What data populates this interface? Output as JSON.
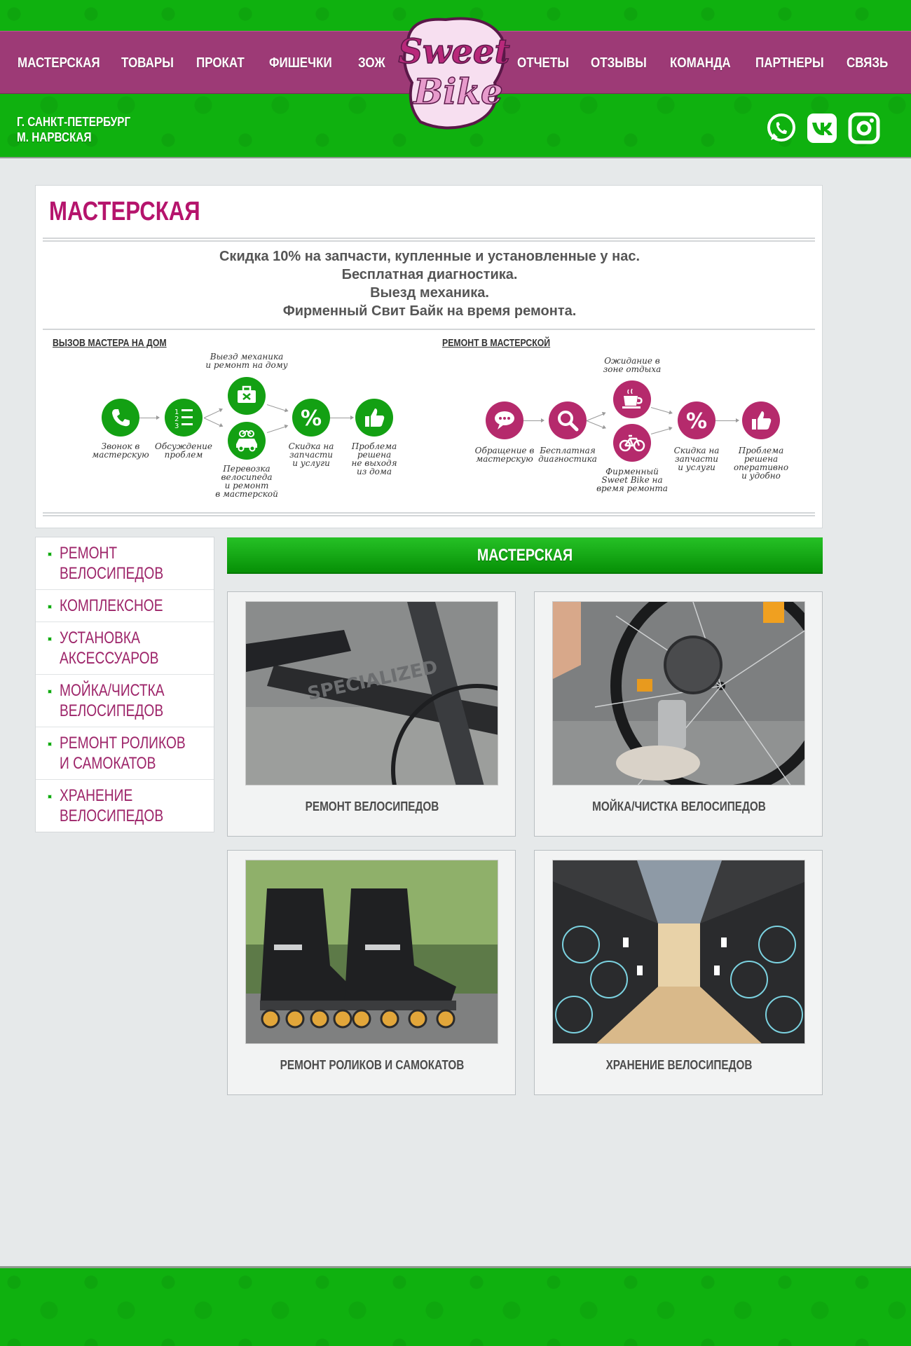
{
  "nav": {
    "items": [
      "МАСТЕРСКАЯ",
      "ТОВАРЫ",
      "ПРОКАТ",
      "ФИШЕЧКИ",
      "ЗОЖ",
      "ОТЧЕТЫ",
      "ОТЗЫВЫ",
      "КОМАНДА",
      "ПАРТНЕРЫ",
      "СВЯЗЬ"
    ],
    "logo_line1": "Sweet",
    "logo_line2": "Bike"
  },
  "location": {
    "city": "Г. САНКТ-ПЕТЕРБУРГ",
    "metro": "М. НАРВСКАЯ"
  },
  "social": [
    "whatsapp-icon",
    "vk-icon",
    "instagram-icon"
  ],
  "colors": {
    "green": "#0fb10f",
    "purple": "#9d3a76",
    "title_magenta": "#b5146c",
    "step_green": "#13a013",
    "step_magenta": "#b52a6c"
  },
  "intro": {
    "title": "МАСТЕРСКАЯ",
    "promo": [
      "Скидка 10% на запчасти, купленные и установленные у нас.",
      "Бесплатная диагностика.",
      "Выезд механика.",
      "Фирменный Свит Байк на время ремонта."
    ],
    "home_service": {
      "heading": "ВЫЗОВ МАСТЕРА НА ДОМ",
      "steps": [
        {
          "icon": "phone-icon",
          "caption": "Звонок в\nмастерскую"
        },
        {
          "icon": "list-icon",
          "caption": "Обсуждение\nпроблем"
        },
        {
          "icon": "toolbox-icon",
          "caption": "Выезд механика\nи ремонт на дому"
        },
        {
          "icon": "car-bike-icon",
          "caption": "Перевозка\nвелосипеда\nи ремонт\nв мастерской"
        },
        {
          "icon": "percent-icon",
          "caption": "Скидка на\nзапчасти\nи услуги"
        },
        {
          "icon": "thumbs-up-icon",
          "caption": "Проблема\nрешена\nне выходя\nиз дома"
        }
      ]
    },
    "workshop": {
      "heading": "РЕМОНТ В МАСТЕРСКОЙ",
      "steps": [
        {
          "icon": "chat-icon",
          "caption": "Обращение в\nмастерскую"
        },
        {
          "icon": "magnifier-icon",
          "caption": "Бесплатная\nдиагностика"
        },
        {
          "icon": "coffee-icon",
          "caption": "Ожидание в\nзоне отдыха"
        },
        {
          "icon": "bicycle-icon",
          "caption": "Фирменный\nSweet Bike на\nвремя ремонта"
        },
        {
          "icon": "percent-icon",
          "caption": "Скидка на\nзапчасти\nи услуги"
        },
        {
          "icon": "thumbs-up-icon",
          "caption": "Проблема\nрешена\nоперативно\nи удобно"
        }
      ]
    }
  },
  "sidebar": {
    "items": [
      "РЕМОНТ\nВЕЛОСИПЕДОВ",
      "КОМПЛЕКСНОЕ",
      "УСТАНОВКА\nАКСЕССУАРОВ",
      "МОЙКА/ЧИСТКА\nВЕЛОСИПЕДОВ",
      "РЕМОНТ РОЛИКОВ\nИ САМОКАТОВ",
      "ХРАНЕНИЕ\nВЕЛОСИПЕДОВ"
    ]
  },
  "main": {
    "title": "МАСТЕРСКАЯ",
    "cards": [
      {
        "label": "РЕМОНТ ВЕЛОСИПЕДОВ",
        "image": "bike-frame-photo"
      },
      {
        "label": "МОЙКА/ЧИСТКА ВЕЛОСИПЕДОВ",
        "image": "bike-cleaning-photo"
      },
      {
        "label": "РЕМОНТ РОЛИКОВ И САМОКАТОВ",
        "image": "rollerblades-photo"
      },
      {
        "label": "ХРАНЕНИЕ ВЕЛОСИПЕДОВ",
        "image": "bike-storage-photo"
      }
    ]
  }
}
